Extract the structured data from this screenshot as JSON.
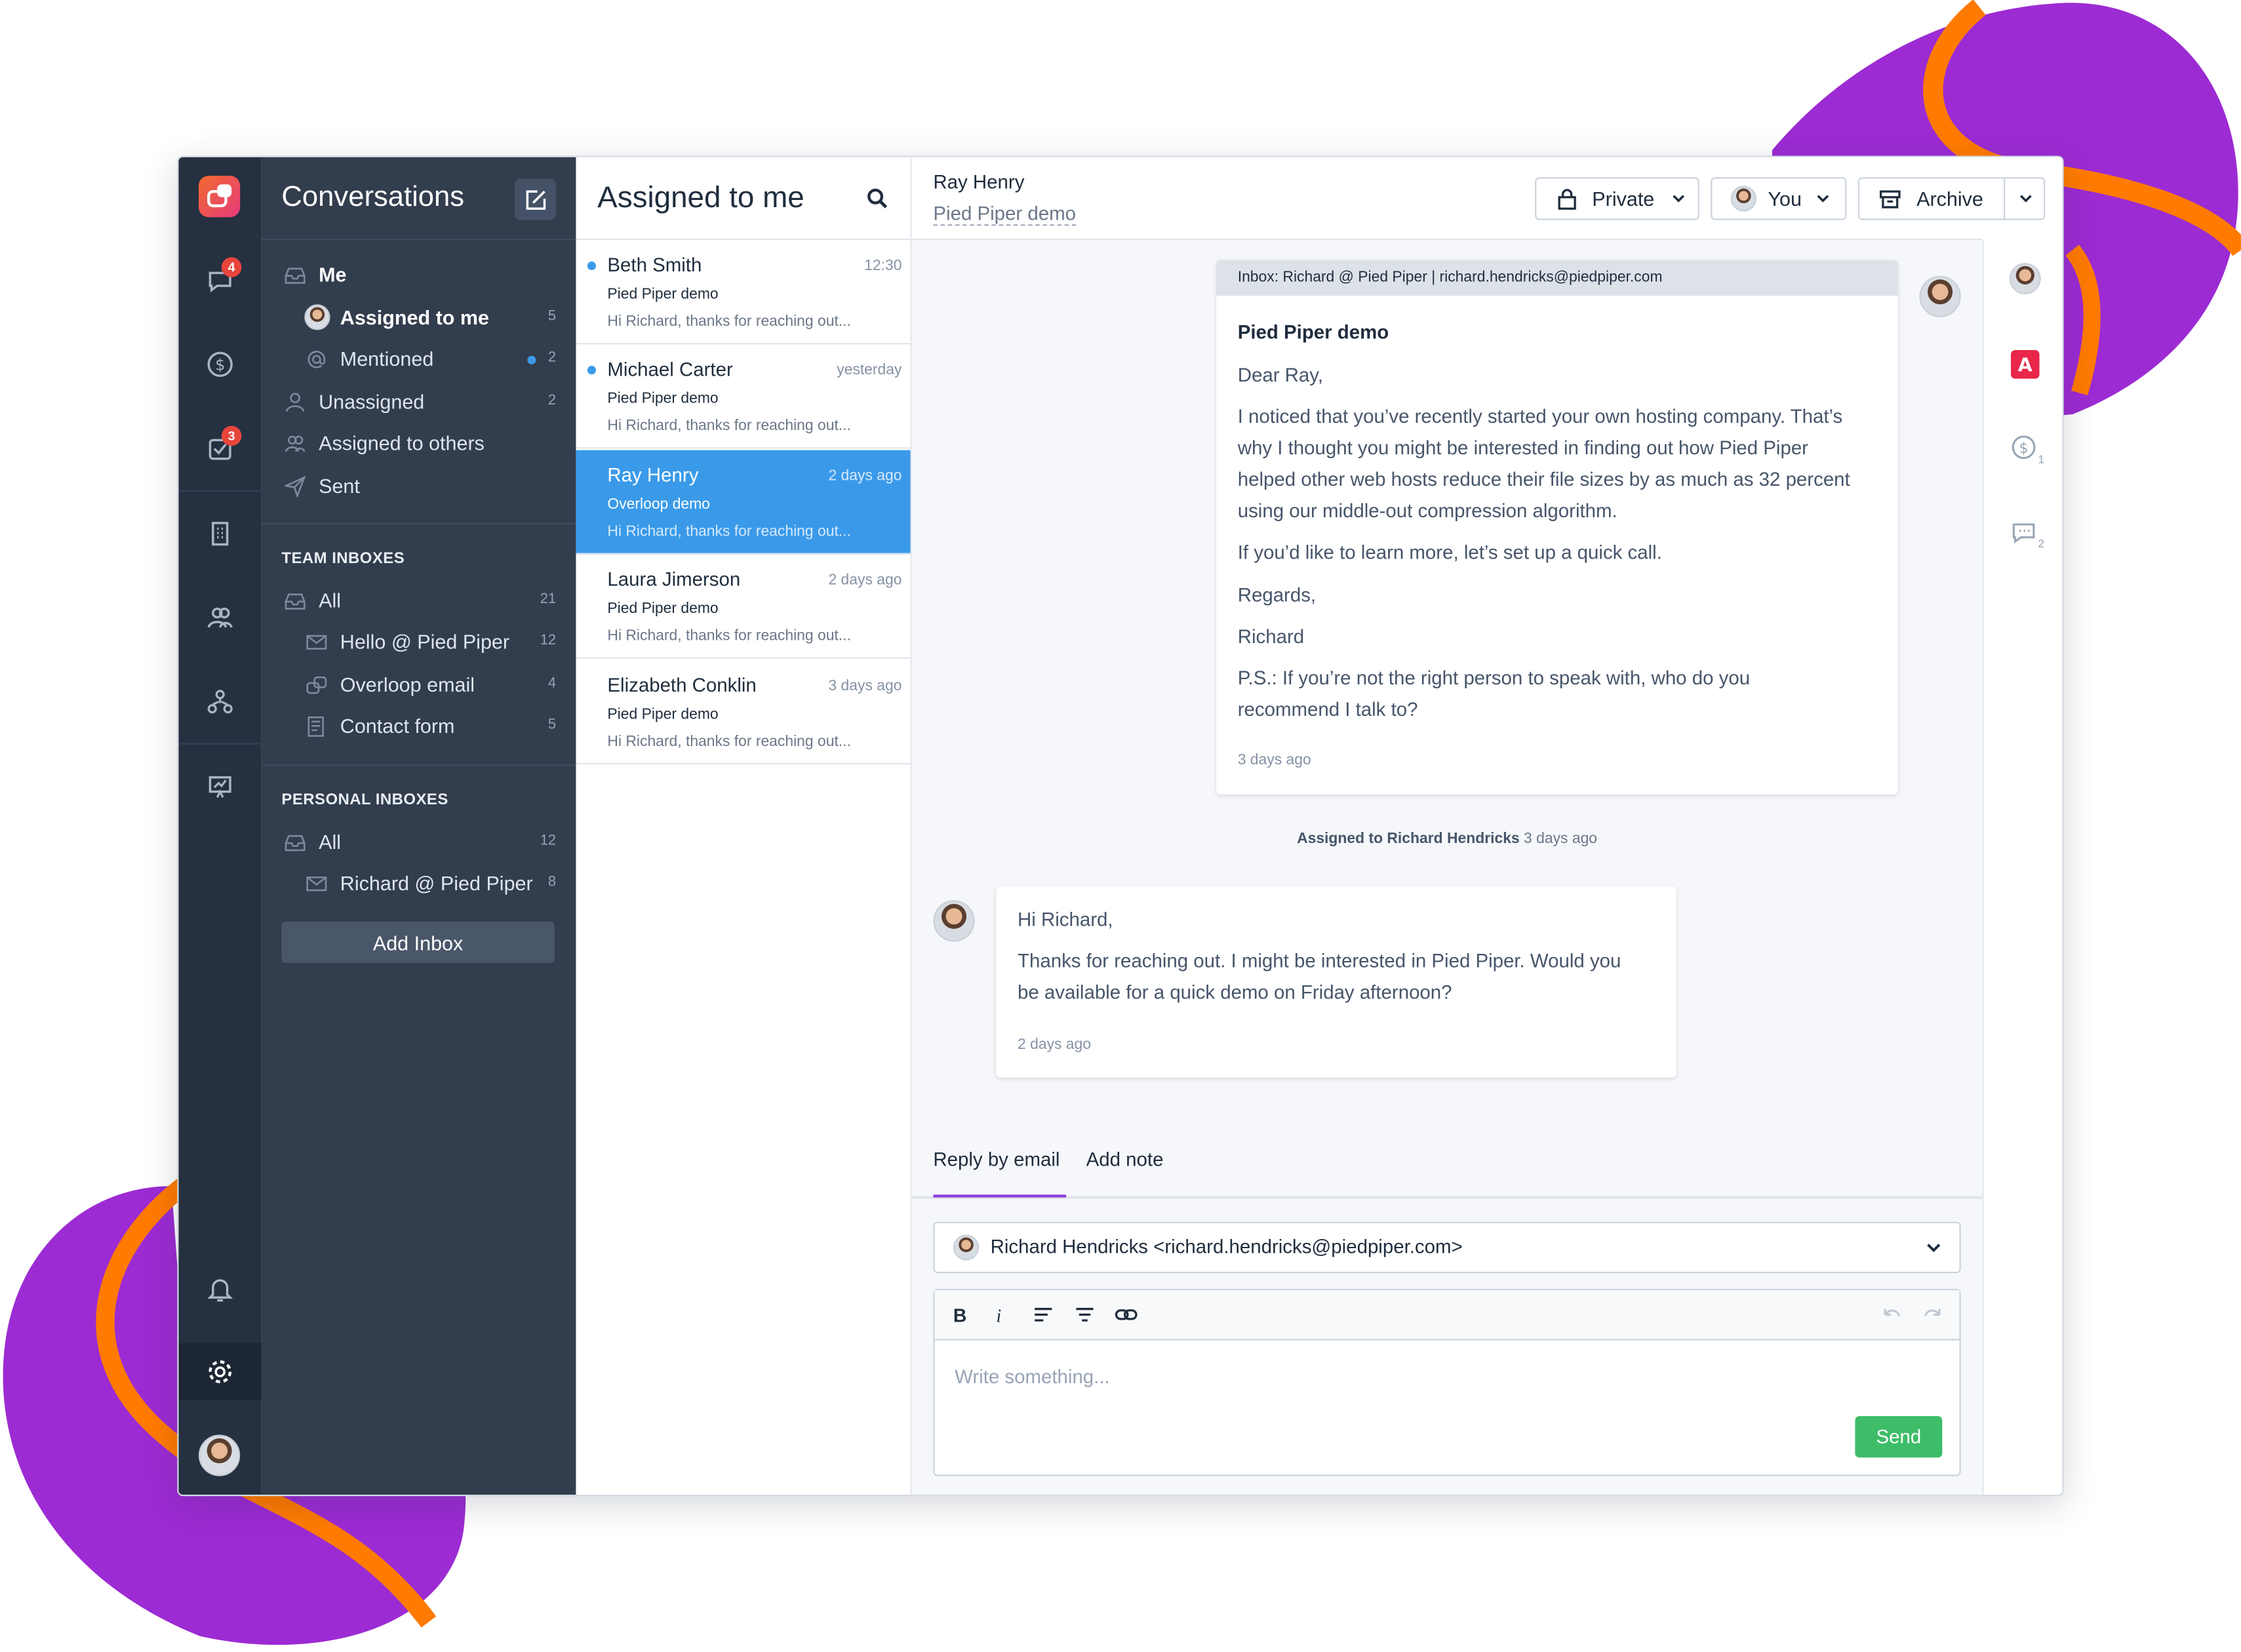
{
  "colors": {
    "rail": "#253040",
    "sidebar": "#323d4d",
    "accent": "#3a9ae9",
    "tab_underline": "#8b3fd8",
    "send": "#3ebd68",
    "badge": "#e8453c"
  },
  "rail": {
    "badges": {
      "conversations": "4",
      "tasks": "3"
    }
  },
  "sidebar": {
    "title": "Conversations",
    "me_label": "Me",
    "me_items": [
      {
        "label": "Assigned to me",
        "count": "5"
      },
      {
        "label": "Mentioned",
        "count": "2"
      },
      {
        "label": "Unassigned",
        "count": "2"
      },
      {
        "label": "Assigned to others",
        "count": ""
      },
      {
        "label": "Sent",
        "count": ""
      }
    ],
    "team_title": "TEAM INBOXES",
    "team_items": [
      {
        "label": "All",
        "count": "21"
      },
      {
        "label": "Hello @ Pied Piper",
        "count": "12"
      },
      {
        "label": "Overloop email",
        "count": "4"
      },
      {
        "label": "Contact form",
        "count": "5"
      }
    ],
    "personal_title": "PERSONAL INBOXES",
    "personal_items": [
      {
        "label": "All",
        "count": "12"
      },
      {
        "label": "Richard @ Pied Piper",
        "count": "8"
      }
    ],
    "add_inbox": "Add Inbox"
  },
  "list": {
    "title": "Assigned to me",
    "conversations": [
      {
        "name": "Beth Smith",
        "time": "12:30",
        "subject": "Pied Piper demo",
        "preview": "Hi Richard, thanks for reaching out...",
        "unread": true
      },
      {
        "name": "Michael Carter",
        "time": "yesterday",
        "subject": "Pied Piper demo",
        "preview": "Hi Richard, thanks for reaching out...",
        "unread": true
      },
      {
        "name": "Ray Henry",
        "time": "2 days ago",
        "subject": "Overloop demo",
        "preview": "Hi Richard, thanks for reaching out...",
        "unread": false
      },
      {
        "name": "Laura Jimerson",
        "time": "2 days ago",
        "subject": "Pied Piper demo",
        "preview": "Hi Richard, thanks for reaching out...",
        "unread": false
      },
      {
        "name": "Elizabeth Conklin",
        "time": "3 days ago",
        "subject": "Pied Piper demo",
        "preview": "Hi Richard, thanks for reaching out...",
        "unread": false
      }
    ]
  },
  "header": {
    "name": "Ray Henry",
    "subject": "Pied Piper demo",
    "private_label": "Private",
    "assignee_label": "You",
    "archive_label": "Archive"
  },
  "thread": {
    "outgoing": {
      "inbox_line": "Inbox: Richard @ Pied Piper | richard.hendricks@piedpiper.com",
      "subject": "Pied Piper demo",
      "greeting": "Dear Ray,",
      "body1_l1": "I noticed that you’ve recently started your own hosting company. That’s",
      "body1_l2": "why I thought you might be interested in finding out how Pied Piper",
      "body1_l3": "helped other web hosts reduce their file sizes by as much as 32 percent",
      "body1_l4": "using our middle-out compression algorithm.",
      "body2": "If you’d like to learn more, let’s set up a quick call.",
      "regards": "Regards,",
      "signature": "Richard",
      "ps_l1": "P.S.: If you’re not the right person to speak with, who do you",
      "ps_l2": "recommend I talk to?",
      "time": "3 days ago"
    },
    "system": {
      "bold": "Assigned to Richard Hendricks",
      "time": "3 days ago"
    },
    "incoming": {
      "greeting": "Hi Richard,",
      "body_l1": "Thanks for reaching out. I might be interested in Pied Piper. Would you",
      "body_l2": "be available for a quick demo on Friday afternoon?",
      "time": "2 days ago"
    }
  },
  "composer": {
    "tab_reply": "Reply by email",
    "tab_note": "Add note",
    "to_value": "Richard Hendricks <richard.hendricks@piedpiper.com>",
    "placeholder": "Write something...",
    "send_label": "Send",
    "bold_label": "B",
    "italic_label": "i"
  },
  "right_panel": {
    "deals_count": "1",
    "conversations_count": "2"
  }
}
